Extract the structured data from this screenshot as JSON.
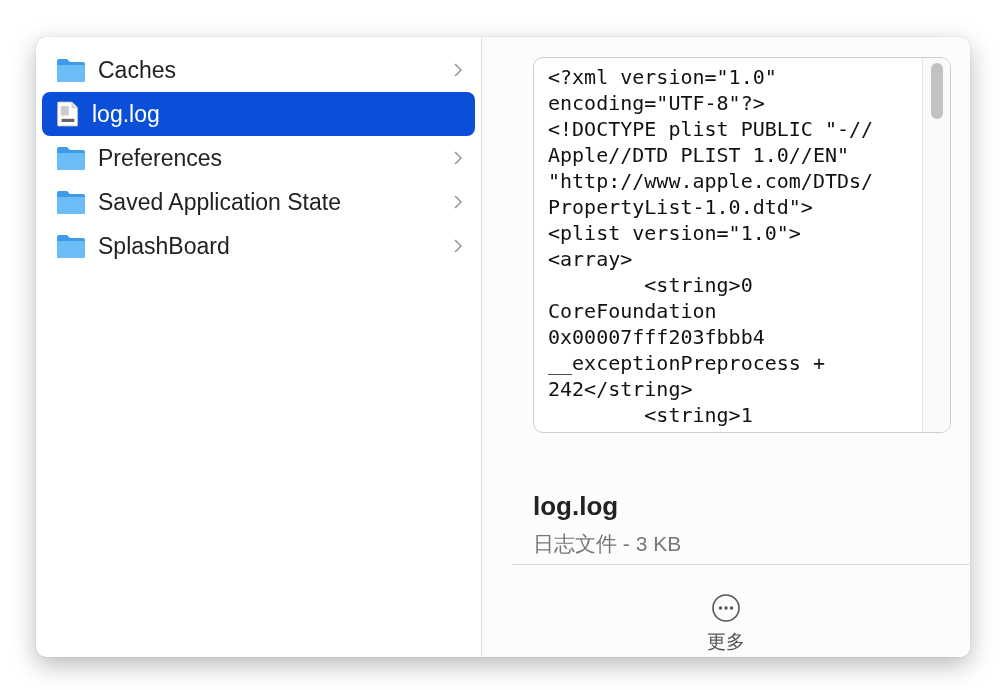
{
  "column": {
    "items": [
      {
        "name": "Caches",
        "kind": "folder",
        "selected": false
      },
      {
        "name": "log.log",
        "kind": "file",
        "selected": true
      },
      {
        "name": "Preferences",
        "kind": "folder",
        "selected": false
      },
      {
        "name": "Saved Application State",
        "kind": "folder",
        "selected": false
      },
      {
        "name": "SplashBoard",
        "kind": "folder",
        "selected": false
      }
    ]
  },
  "preview": {
    "lines": [
      "<?xml version=\"1.0\"",
      "encoding=\"UTF-8\"?>",
      "<!DOCTYPE plist PUBLIC \"-//",
      "Apple//DTD PLIST 1.0//EN\"",
      "\"http://www.apple.com/DTDs/",
      "PropertyList-1.0.dtd\">",
      "<plist version=\"1.0\">",
      "<array>",
      "        <string>0",
      "CoreFoundation",
      "0x00007fff203fbbb4",
      "__exceptionPreprocess +",
      "242</string>",
      "        <string>1"
    ],
    "title": "log.log",
    "subtitle": "日志文件 - 3 KB"
  },
  "actions": [
    {
      "label": "更多"
    }
  ]
}
